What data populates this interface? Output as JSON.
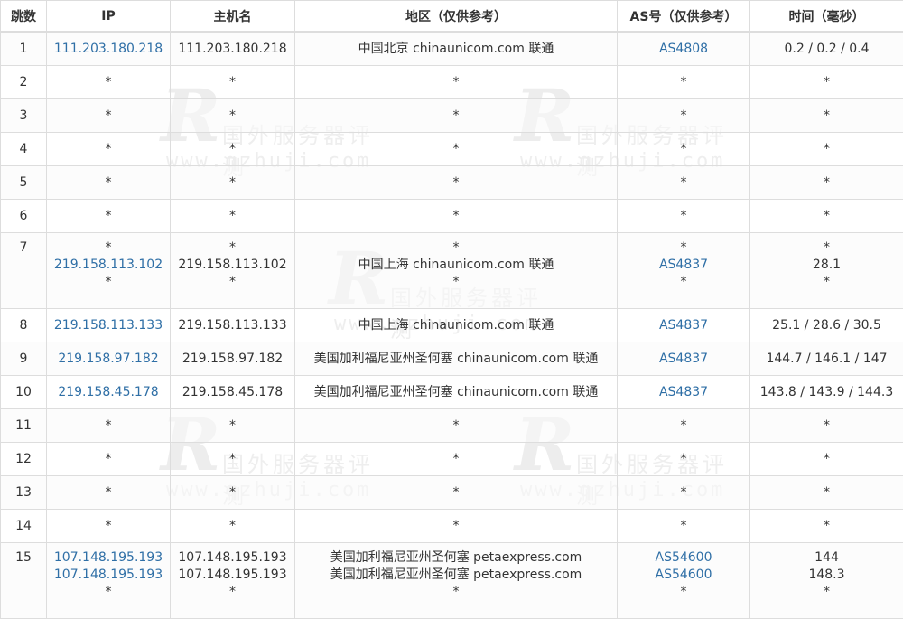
{
  "headers": {
    "hop": "跳数",
    "ip": "IP",
    "host": "主机名",
    "region": "地区（仅供参考）",
    "as": "AS号（仅供参考）",
    "time": "时间（毫秒）"
  },
  "watermark": {
    "cn": "国外服务器评测",
    "url": "www.qzhuji.com"
  },
  "rows": [
    {
      "hop": "1",
      "ip": [
        "111.203.180.218"
      ],
      "host": [
        "111.203.180.218"
      ],
      "region": [
        "中国北京 chinaunicom.com 联通"
      ],
      "as": [
        "AS4808"
      ],
      "time": [
        "0.2 / 0.2 / 0.4"
      ]
    },
    {
      "hop": "2",
      "ip": [
        "*"
      ],
      "host": [
        "*"
      ],
      "region": [
        "*"
      ],
      "as": [
        "*"
      ],
      "time": [
        "*"
      ]
    },
    {
      "hop": "3",
      "ip": [
        "*"
      ],
      "host": [
        "*"
      ],
      "region": [
        "*"
      ],
      "as": [
        "*"
      ],
      "time": [
        "*"
      ]
    },
    {
      "hop": "4",
      "ip": [
        "*"
      ],
      "host": [
        "*"
      ],
      "region": [
        "*"
      ],
      "as": [
        "*"
      ],
      "time": [
        "*"
      ]
    },
    {
      "hop": "5",
      "ip": [
        "*"
      ],
      "host": [
        "*"
      ],
      "region": [
        "*"
      ],
      "as": [
        "*"
      ],
      "time": [
        "*"
      ]
    },
    {
      "hop": "6",
      "ip": [
        "*"
      ],
      "host": [
        "*"
      ],
      "region": [
        "*"
      ],
      "as": [
        "*"
      ],
      "time": [
        "*"
      ]
    },
    {
      "hop": "7",
      "ip": [
        "*",
        "219.158.113.102",
        "*"
      ],
      "host": [
        "*",
        "219.158.113.102",
        "*"
      ],
      "region": [
        "*",
        "中国上海 chinaunicom.com 联通",
        "*"
      ],
      "as": [
        "*",
        "AS4837",
        "*"
      ],
      "time": [
        "*",
        "28.1",
        "*"
      ]
    },
    {
      "hop": "8",
      "ip": [
        "219.158.113.133"
      ],
      "host": [
        "219.158.113.133"
      ],
      "region": [
        "中国上海 chinaunicom.com 联通"
      ],
      "as": [
        "AS4837"
      ],
      "time": [
        "25.1 / 28.6 / 30.5"
      ]
    },
    {
      "hop": "9",
      "ip": [
        "219.158.97.182"
      ],
      "host": [
        "219.158.97.182"
      ],
      "region": [
        "美国加利福尼亚州圣何塞 chinaunicom.com 联通"
      ],
      "as": [
        "AS4837"
      ],
      "time": [
        "144.7 / 146.1 / 147"
      ]
    },
    {
      "hop": "10",
      "ip": [
        "219.158.45.178"
      ],
      "host": [
        "219.158.45.178"
      ],
      "region": [
        "美国加利福尼亚州圣何塞 chinaunicom.com 联通"
      ],
      "as": [
        "AS4837"
      ],
      "time": [
        "143.8 / 143.9 / 144.3"
      ]
    },
    {
      "hop": "11",
      "ip": [
        "*"
      ],
      "host": [
        "*"
      ],
      "region": [
        "*"
      ],
      "as": [
        "*"
      ],
      "time": [
        "*"
      ]
    },
    {
      "hop": "12",
      "ip": [
        "*"
      ],
      "host": [
        "*"
      ],
      "region": [
        "*"
      ],
      "as": [
        "*"
      ],
      "time": [
        "*"
      ]
    },
    {
      "hop": "13",
      "ip": [
        "*"
      ],
      "host": [
        "*"
      ],
      "region": [
        "*"
      ],
      "as": [
        "*"
      ],
      "time": [
        "*"
      ]
    },
    {
      "hop": "14",
      "ip": [
        "*"
      ],
      "host": [
        "*"
      ],
      "region": [
        "*"
      ],
      "as": [
        "*"
      ],
      "time": [
        "*"
      ]
    },
    {
      "hop": "15",
      "ip": [
        "107.148.195.193",
        "107.148.195.193",
        "*"
      ],
      "host": [
        "107.148.195.193",
        "107.148.195.193",
        "*"
      ],
      "region": [
        "美国加利福尼亚州圣何塞 petaexpress.com",
        "美国加利福尼亚州圣何塞 petaexpress.com",
        "*"
      ],
      "as": [
        "AS54600",
        "AS54600",
        "*"
      ],
      "time": [
        "144",
        "148.3",
        "*"
      ]
    }
  ]
}
